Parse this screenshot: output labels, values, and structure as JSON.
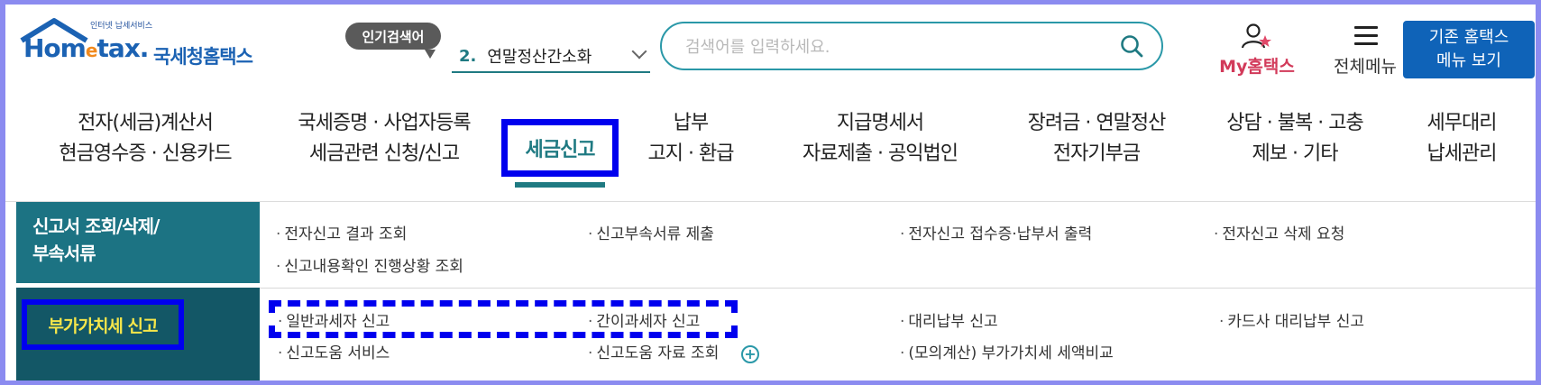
{
  "header": {
    "logo_small": "인터넷 납세서비스",
    "logo_word_1": "Hom",
    "logo_word_e": "e",
    "logo_word_2": "tax.",
    "logo_kr": "국세청홈택스",
    "popular_badge": "인기검색어",
    "popular_rank": "2.",
    "popular_keyword": "연말정산간소화",
    "search_placeholder": "검색어를 입력하세요.",
    "my_hometax": "My홈택스",
    "all_menu": "전체메뉴",
    "old_menu_line1": "기존 홈택스",
    "old_menu_line2": "메뉴 보기"
  },
  "nav": {
    "items": [
      {
        "line1": "전자(세금)계산서",
        "line2": "현금영수증 · 신용카드"
      },
      {
        "line1": "국세증명 · 사업자등록",
        "line2": "세금관련 신청/신고"
      },
      {
        "line1": "세금신고",
        "line2": ""
      },
      {
        "line1": "납부",
        "line2": "고지 · 환급"
      },
      {
        "line1": "지급명세서",
        "line2": "자료제출 · 공익법인"
      },
      {
        "line1": "장려금 · 연말정산",
        "line2": "전자기부금"
      },
      {
        "line1": "상담 · 불복 · 고충",
        "line2": "제보 · 기타"
      },
      {
        "line1": "세무대리",
        "line2": "납세관리"
      }
    ],
    "active_index": 2
  },
  "submenu": {
    "categories": [
      {
        "title_line1": "신고서 조회/삭제/",
        "title_line2": "부속서류"
      },
      {
        "title_line1": "부가가치세 신고",
        "title_line2": ""
      }
    ],
    "rows": [
      [
        "전자신고 결과 조회",
        "신고부속서류 제출",
        "전자신고 접수증·납부서 출력",
        "전자신고 삭제 요청",
        "신고내용확인 진행상황 조회"
      ],
      [
        "일반과세자 신고",
        "간이과세자 신고",
        "대리납부 신고",
        "카드사 대리납부 신고",
        "신고도움 서비스",
        "신고도움 자료 조회",
        "(모의계산) 부가가치세 세액비교"
      ]
    ]
  },
  "colors": {
    "accent": "#1f7a82",
    "brand": "#1b62b3",
    "highlight": "#0000ee"
  }
}
